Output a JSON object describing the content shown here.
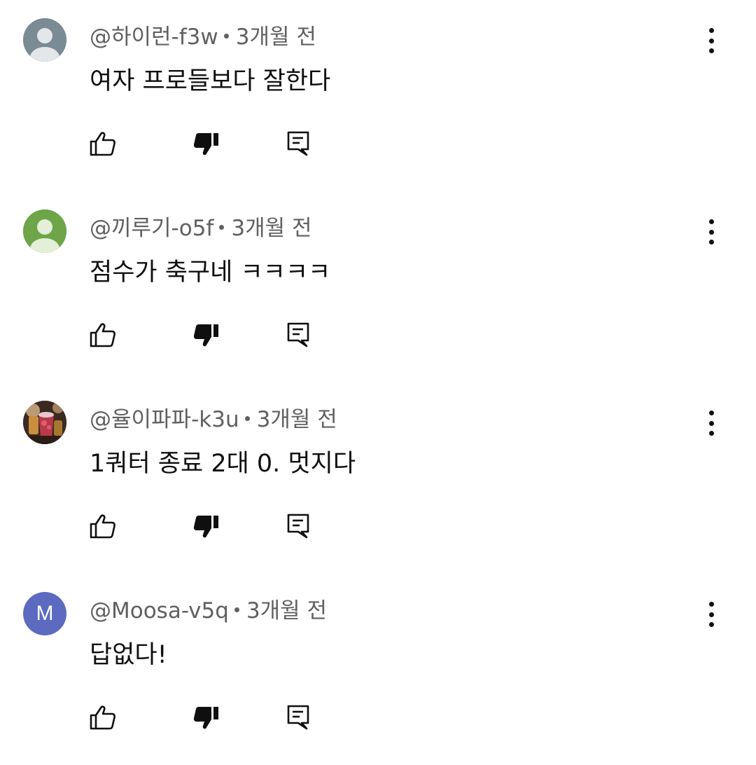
{
  "comments": [
    {
      "author": "@하이런-f3w",
      "time": "3개월 전",
      "text": "여자 프로들보다 잘한다",
      "avatar": {
        "type": "default",
        "color": "#7a8b95",
        "icon": "person-icon"
      }
    },
    {
      "author": "@끼루기-o5f",
      "time": "3개월 전",
      "text": "점수가 축구네 ㅋㅋㅋㅋ",
      "avatar": {
        "type": "default",
        "color": "#6da548",
        "icon": "person-icon"
      }
    },
    {
      "author": "@율이파파-k3u",
      "time": "3개월 전",
      "text": "1쿼터 종료 2대 0. 멋지다",
      "avatar": {
        "type": "photo",
        "color": "#5a3a2a",
        "icon": "photo-avatar"
      }
    },
    {
      "author": "@Moosa-v5q",
      "time": "3개월 전",
      "text": "답없다!",
      "avatar": {
        "type": "letter",
        "color": "#5c6bc0",
        "letter": "M"
      }
    }
  ],
  "actions": {
    "like_icon": "thumbs-up-outline-icon",
    "dislike_icon": "thumbs-down-filled-icon",
    "reply_icon": "reply-comment-icon",
    "more_icon": "vertical-dots-icon"
  }
}
